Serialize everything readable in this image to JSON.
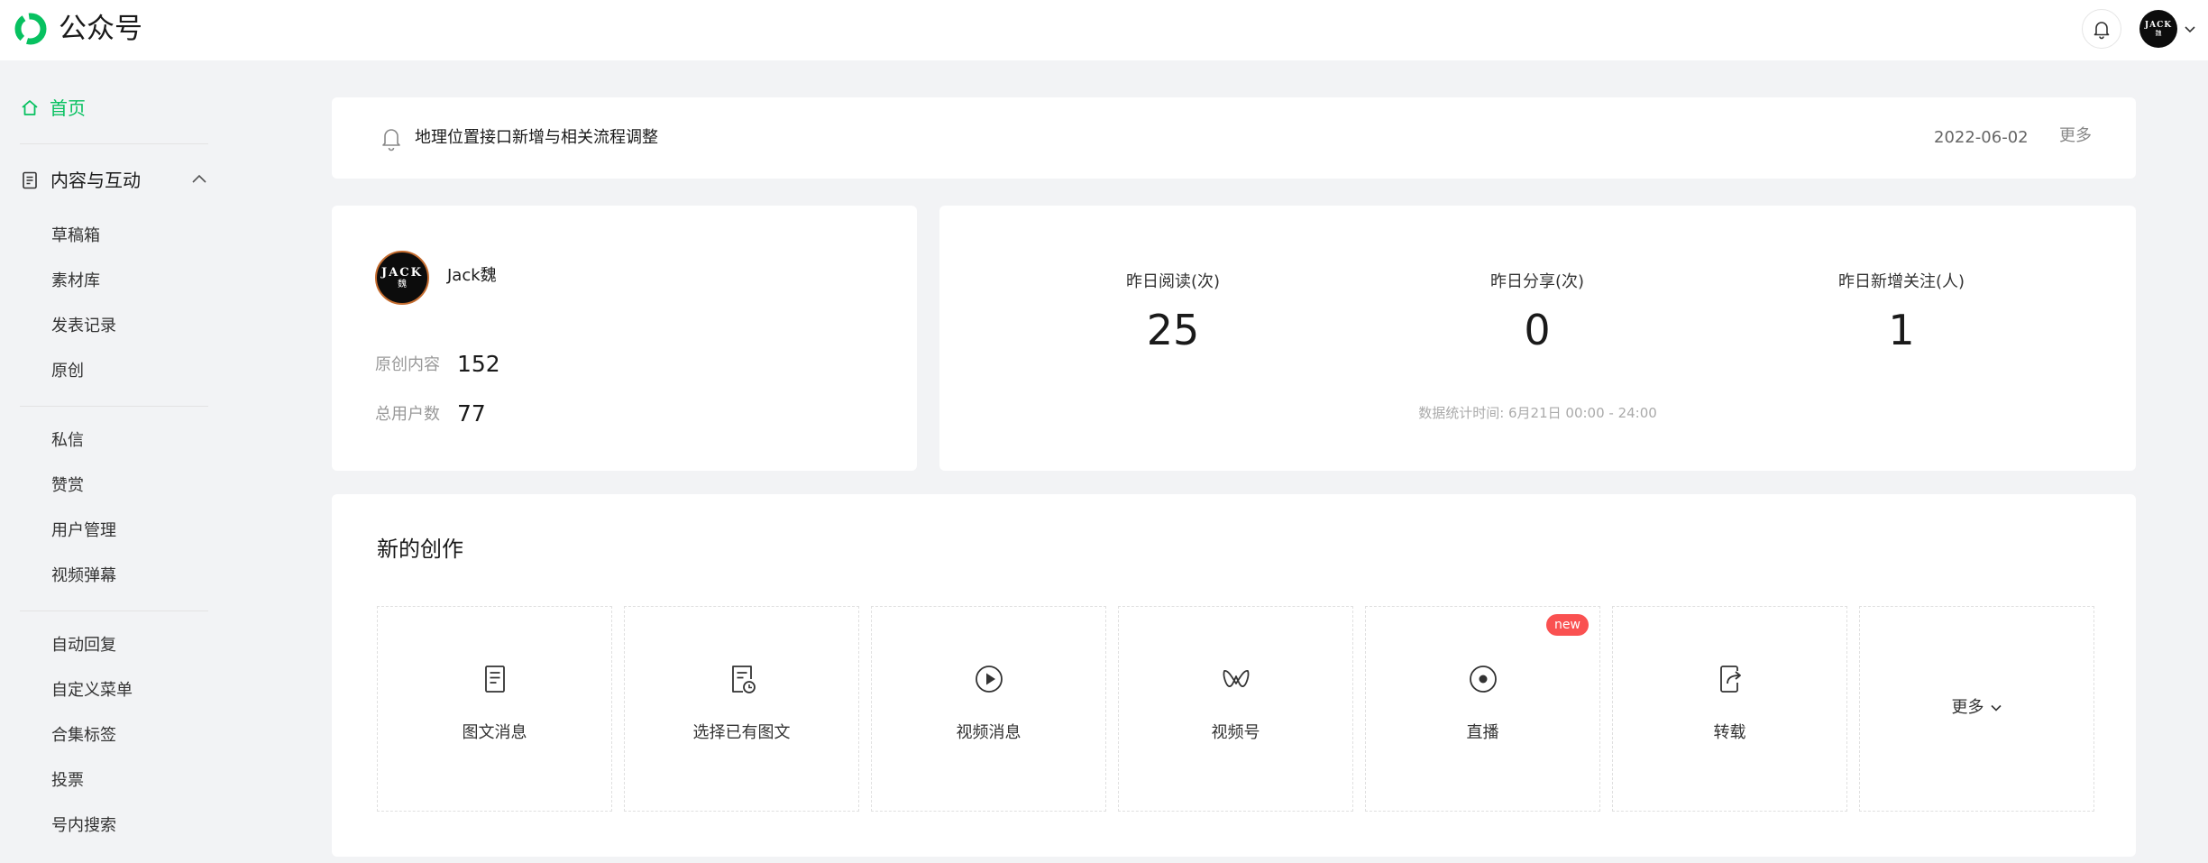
{
  "app": {
    "title": "公众号",
    "brand_color": "#07c160",
    "avatar_text": "JACK",
    "avatar_subtext": "魏"
  },
  "sidebar": {
    "home": "首页",
    "group_label": "内容与互动",
    "group_items": [
      "草稿箱",
      "素材库",
      "发表记录",
      "原创"
    ],
    "section2": [
      "私信",
      "赞赏",
      "用户管理",
      "视频弹幕"
    ],
    "section3": [
      "自动回复",
      "自定义菜单",
      "合集标签",
      "投票",
      "号内搜索"
    ]
  },
  "notice": {
    "text": "地理位置接口新增与相关流程调整",
    "date": "2022-06-02",
    "more": "更多"
  },
  "account": {
    "name": "Jack魏",
    "original_label": "原创内容",
    "original_value": "152",
    "users_label": "总用户数",
    "users_value": "77"
  },
  "stats": {
    "items": [
      {
        "label": "昨日阅读(次)",
        "value": "25"
      },
      {
        "label": "昨日分享(次)",
        "value": "0"
      },
      {
        "label": "昨日新增关注(人)",
        "value": "1"
      }
    ],
    "time_note": "数据统计时间: 6月21日 00:00 - 24:00"
  },
  "create": {
    "title": "新的创作",
    "tiles": [
      {
        "label": "图文消息",
        "icon": "article-icon"
      },
      {
        "label": "选择已有图文",
        "icon": "article-history-icon"
      },
      {
        "label": "视频消息",
        "icon": "play-icon"
      },
      {
        "label": "视频号",
        "icon": "channels-icon"
      },
      {
        "label": "直播",
        "icon": "live-icon",
        "badge": "new"
      },
      {
        "label": "转载",
        "icon": "repost-icon"
      }
    ],
    "more": "更多"
  }
}
